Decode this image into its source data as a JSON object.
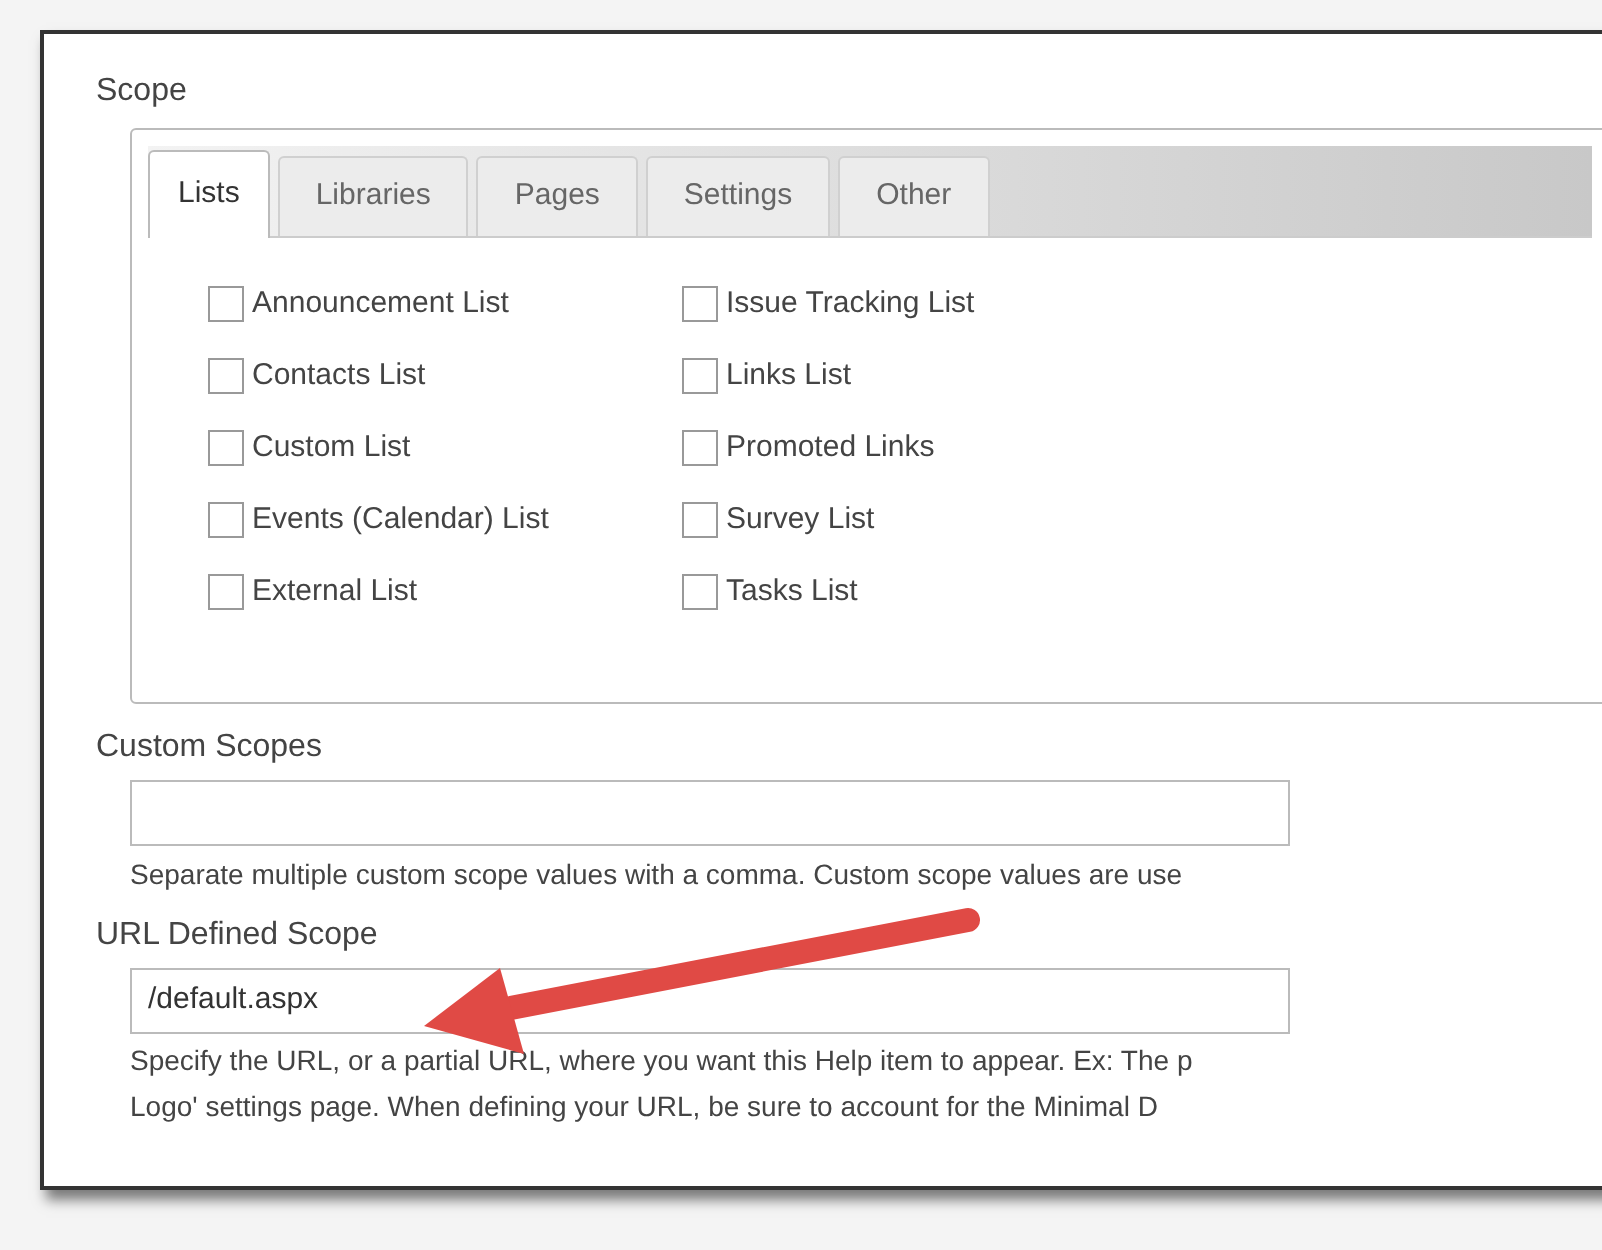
{
  "scope": {
    "label": "Scope",
    "tabs": [
      {
        "label": "Lists",
        "selected": true
      },
      {
        "label": "Libraries",
        "selected": false
      },
      {
        "label": "Pages",
        "selected": false
      },
      {
        "label": "Settings",
        "selected": false
      },
      {
        "label": "Other",
        "selected": false
      }
    ],
    "columns": [
      [
        {
          "label": "Announcement List",
          "checked": false
        },
        {
          "label": "Contacts List",
          "checked": false
        },
        {
          "label": "Custom List",
          "checked": false
        },
        {
          "label": "Events (Calendar) List",
          "checked": false
        },
        {
          "label": "External List",
          "checked": false
        }
      ],
      [
        {
          "label": "Issue Tracking List",
          "checked": false
        },
        {
          "label": "Links List",
          "checked": false
        },
        {
          "label": "Promoted Links",
          "checked": false
        },
        {
          "label": "Survey List",
          "checked": false
        },
        {
          "label": "Tasks List",
          "checked": false
        }
      ]
    ]
  },
  "custom_scopes": {
    "label": "Custom Scopes",
    "help": [
      "Separate multiple custom scope values with a comma. Custom scope values are use"
    ]
  },
  "url_defined_scope": {
    "label": "URL Defined Scope",
    "value": "/default.aspx",
    "help": [
      "Specify the URL, or a partial URL, where you want this Help item to appear. Ex: The p",
      "Logo' settings page. When defining your URL, be sure to account for the Minimal D"
    ]
  }
}
